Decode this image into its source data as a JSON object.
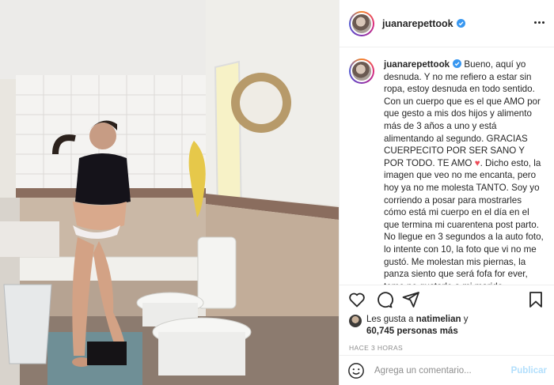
{
  "post": {
    "username": "juanarepettook",
    "more_icon": "more-horizontal-icon",
    "verified_color": "#3897f0"
  },
  "caption": {
    "username": "juanarepettook",
    "text_before_heart": "Bueno, aquí yo desnuda. Y no me refiero a estar sin ropa, estoy desnuda en todo sentido. Con un cuerpo que es el que AMO por que gesto a mis dos hijos y alimento más de 3 años a uno y está alimentando al segundo. GRACIAS CUERPECITO POR SER SANO Y POR TODO. TE AMO",
    "heart": "♥",
    "text_after_heart": ". Dicho esto, la imagen que veo no me encanta, pero hoy ya no me molesta TANTO. Soy yo corriendo a posar para mostrarles cómo está mi cuerpo en el día en el que termina mi cuarentena post parto. No llegue en 3 segundos a la auto foto, lo intente con 10, la foto que vi no me gustó. Me molestan mis piernas, la panza siento que será fofa for ever, tomo no gustarle a mi marido"
  },
  "actions": {
    "like_icon": "heart-outline-icon",
    "comment_icon": "comment-icon",
    "share_icon": "send-icon",
    "save_icon": "bookmark-icon"
  },
  "likes": {
    "prefix": "Les gusta a",
    "first_user": "natimelian",
    "joiner": "y",
    "count_text": "60,745 personas más"
  },
  "time_ago": "HACE 3 HORAS",
  "comment": {
    "placeholder": "Agrega un comentario...",
    "publish_label": "Publicar",
    "emoji_icon": "emoji-smile-icon"
  },
  "colors": {
    "text": "#262626",
    "secondary": "#8e8e8e",
    "publish_disabled": "#b2dffc",
    "heart": "#ed4956"
  }
}
